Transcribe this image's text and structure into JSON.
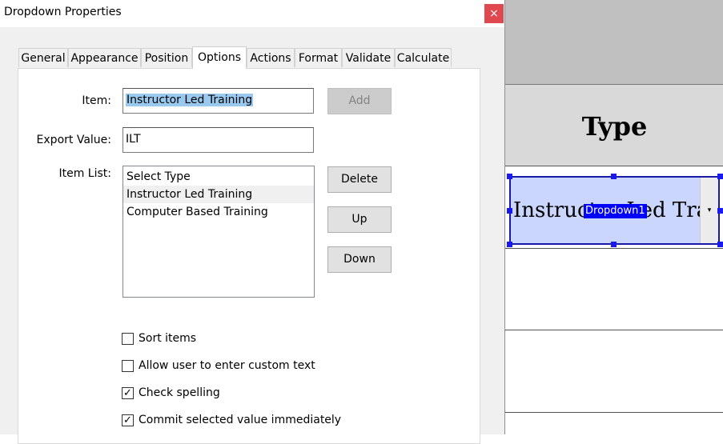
{
  "dialog": {
    "title": "Dropdown Properties",
    "close_label": "×"
  },
  "tabs": [
    {
      "label": "General"
    },
    {
      "label": "Appearance"
    },
    {
      "label": "Position"
    },
    {
      "label": "Options",
      "active": true
    },
    {
      "label": "Actions"
    },
    {
      "label": "Format"
    },
    {
      "label": "Validate"
    },
    {
      "label": "Calculate"
    }
  ],
  "options": {
    "item_label": "Item:",
    "item_value": "Instructor Led Training",
    "export_label": "Export Value:",
    "export_value": "ILT",
    "item_list_label": "Item List:",
    "items": [
      "Select Type",
      "Instructor Led Training",
      "Computer Based Training"
    ],
    "selected_index": 1,
    "buttons": {
      "add": "Add",
      "delete": "Delete",
      "up": "Up",
      "down": "Down"
    },
    "checkboxes": [
      {
        "label": "Sort items",
        "checked": false
      },
      {
        "label": "Allow user to enter custom text",
        "checked": false
      },
      {
        "label": "Check spelling",
        "checked": true
      },
      {
        "label": "Commit selected value immediately",
        "checked": true
      }
    ]
  },
  "document": {
    "column_header": "Type",
    "dropdown_value": "Instructor Led Training",
    "field_name": "Dropdown1",
    "arrow": "▾"
  },
  "colors": {
    "close_button": "#e0484f",
    "selection_highlight": "#99c9ef",
    "field_fill": "#cbd6ff",
    "field_border": "#1a1aaa",
    "field_name_bg": "#0000ff"
  }
}
